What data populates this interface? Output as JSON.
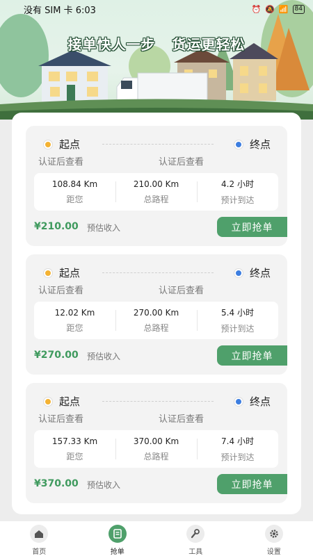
{
  "status_bar": {
    "carrier": "没有 SIM 卡",
    "time": "6:03",
    "battery": "84"
  },
  "banner": {
    "slogan_left": "接单快人一步",
    "slogan_right": "货运更轻松"
  },
  "orders": [
    {
      "start_label": "起点",
      "end_label": "终点",
      "start_addr": "认证后查看",
      "end_addr": "认证后查看",
      "distance_to_you": "108.84 Km",
      "distance_to_you_label": "距您",
      "total_distance": "210.00 Km",
      "total_distance_label": "总路程",
      "eta": "4.2 小时",
      "eta_label": "预计到达",
      "price": "¥210.00",
      "price_label": "预估收入",
      "button": "立即抢单"
    },
    {
      "start_label": "起点",
      "end_label": "终点",
      "start_addr": "认证后查看",
      "end_addr": "认证后查看",
      "distance_to_you": "12.02 Km",
      "distance_to_you_label": "距您",
      "total_distance": "270.00 Km",
      "total_distance_label": "总路程",
      "eta": "5.4 小时",
      "eta_label": "预计到达",
      "price": "¥270.00",
      "price_label": "预估收入",
      "button": "立即抢单"
    },
    {
      "start_label": "起点",
      "end_label": "终点",
      "start_addr": "认证后查看",
      "end_addr": "认证后查看",
      "distance_to_you": "157.33 Km",
      "distance_to_you_label": "距您",
      "total_distance": "370.00 Km",
      "total_distance_label": "总路程",
      "eta": "7.4 小时",
      "eta_label": "预计到达",
      "price": "¥370.00",
      "price_label": "预估收入",
      "button": "立即抢单"
    }
  ],
  "tabs": [
    {
      "label": "首页",
      "icon": "home-icon",
      "active": false
    },
    {
      "label": "抢单",
      "icon": "order-list-icon",
      "active": true
    },
    {
      "label": "工具",
      "icon": "wrench-icon",
      "active": false
    },
    {
      "label": "设置",
      "icon": "gear-icon",
      "active": false
    }
  ],
  "colors": {
    "accent": "#4fa06b",
    "price": "#3f9a5e",
    "start_dot": "#f4b233",
    "end_dot": "#3d7ee0"
  }
}
